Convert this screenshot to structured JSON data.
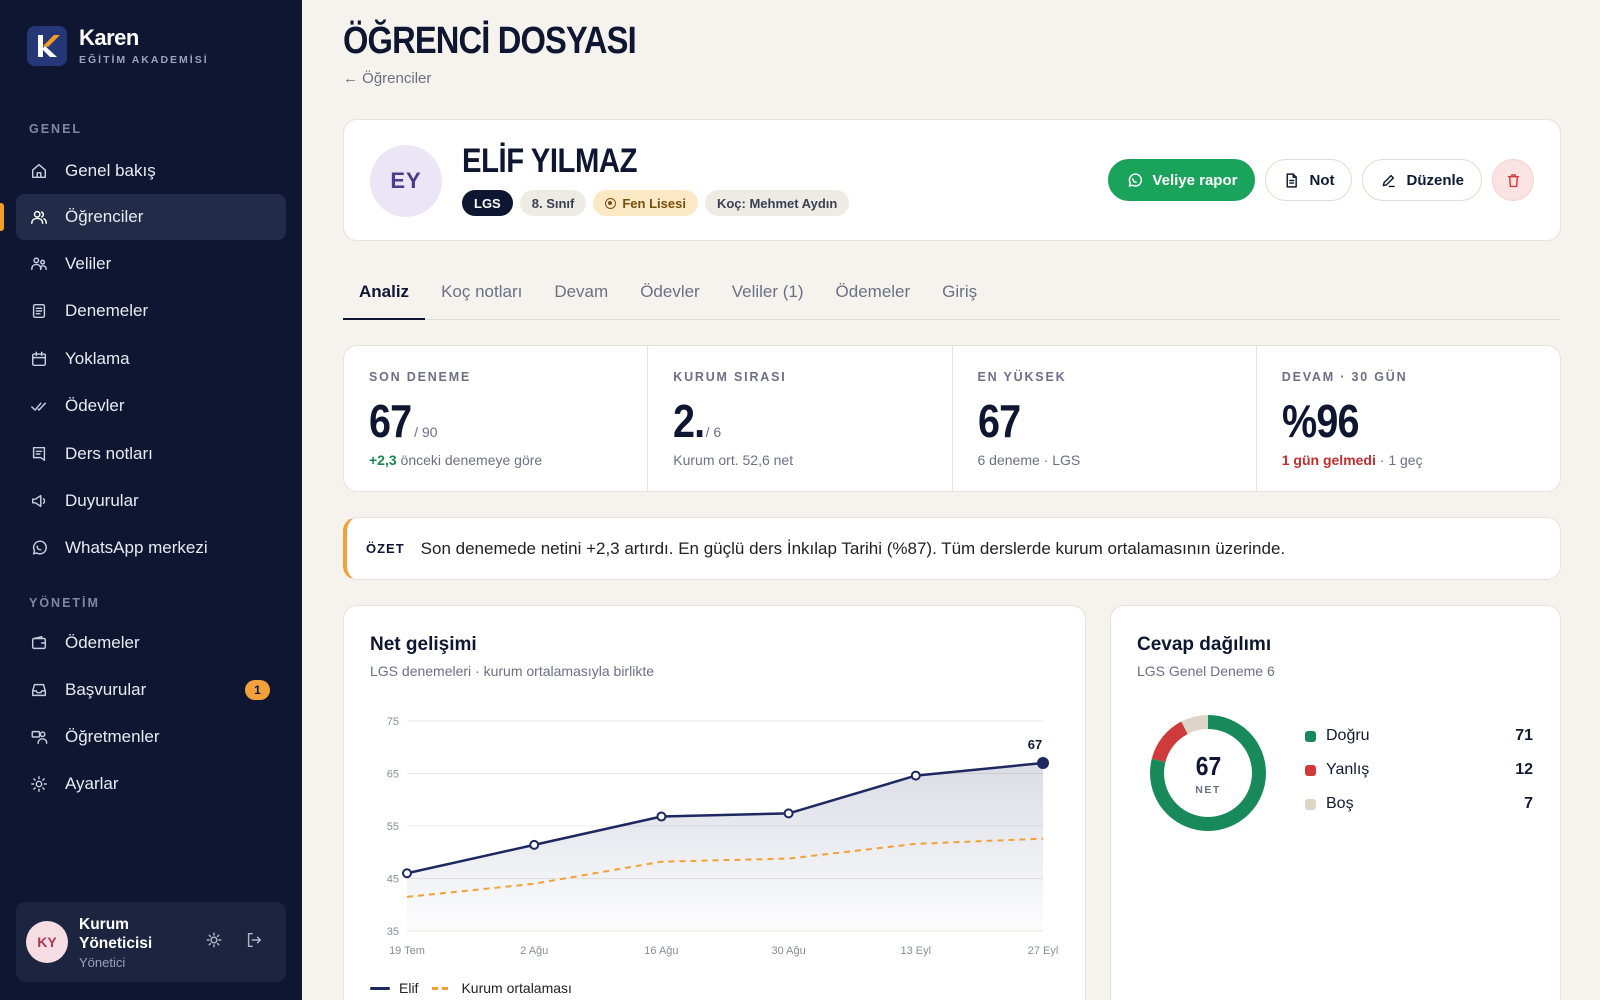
{
  "brand": {
    "name": "Karen",
    "subtitle": "EĞİTİM AKADEMİSİ"
  },
  "sidebar": {
    "section_general": "GENEL",
    "general_items": [
      {
        "label": "Genel bakış",
        "icon": "home-icon"
      },
      {
        "label": "Öğrenciler",
        "icon": "users-icon",
        "active": true
      },
      {
        "label": "Veliler",
        "icon": "parents-icon"
      },
      {
        "label": "Denemeler",
        "icon": "document-icon"
      },
      {
        "label": "Yoklama",
        "icon": "calendar-icon"
      },
      {
        "label": "Ödevler",
        "icon": "double-check-icon"
      },
      {
        "label": "Ders notları",
        "icon": "notes-icon"
      },
      {
        "label": "Duyurular",
        "icon": "megaphone-icon"
      },
      {
        "label": "WhatsApp merkezi",
        "icon": "whatsapp-icon"
      }
    ],
    "section_admin": "YÖNETİM",
    "admin_items": [
      {
        "label": "Ödemeler",
        "icon": "wallet-icon"
      },
      {
        "label": "Başvurular",
        "icon": "inbox-icon",
        "badge": "1"
      },
      {
        "label": "Öğretmenler",
        "icon": "teacher-icon"
      },
      {
        "label": "Ayarlar",
        "icon": "settings-icon"
      }
    ],
    "user": {
      "initials": "KY",
      "name": "Kurum Yöneticisi",
      "role": "Yönetici"
    }
  },
  "page": {
    "title": "ÖĞRENCİ DOSYASI",
    "back": "← Öğrenciler"
  },
  "student": {
    "initials": "EY",
    "name": "ELİF YILMAZ",
    "chips": {
      "exam": "LGS",
      "grade": "8. Sınıf",
      "target": "Fen Lisesi",
      "coach": "Koç: Mehmet Aydın"
    },
    "actions": {
      "report": "Veliye rapor",
      "note": "Not",
      "edit": "Düzenle"
    }
  },
  "tabs": [
    "Analiz",
    "Koç notları",
    "Devam",
    "Ödevler",
    "Veliler (1)",
    "Ödemeler",
    "Giriş"
  ],
  "stats": [
    {
      "label": "SON DENEME",
      "value": "67",
      "unit": "/ 90",
      "note_hl": "+2,3",
      "note": " önceki denemeye göre"
    },
    {
      "label": "KURUM SIRASI",
      "value": "2.",
      "unit": "/ 6",
      "note_hl": "",
      "note": "Kurum ort. 52,6 net"
    },
    {
      "label": "EN YÜKSEK",
      "value": "67",
      "unit": "",
      "note_hl": "",
      "note": "6 deneme · LGS"
    },
    {
      "label": "DEVAM · 30 GÜN",
      "value": "%96",
      "unit": "",
      "note_hl": "1 gün gelmedi",
      "note": " · 1 geç"
    }
  ],
  "summary": {
    "tag": "ÖZET",
    "text": "Son denemede netini +2,3 artırdı. En güçlü ders İnkılap Tarihi (%87). Tüm derslerde kurum ortalamasının üzerinde."
  },
  "chart_card": {
    "title": "Net gelişimi",
    "subtitle": "LGS denemeleri · kurum ortalamasıyla birlikte"
  },
  "chart_data": {
    "type": "line",
    "title": "Net gelişimi",
    "subtitle": "LGS denemeleri · kurum ortalamasıyla birlikte",
    "categories": [
      "19 Tem",
      "2 Ağu",
      "16 Ağu",
      "30 Ağu",
      "13 Eyl",
      "27 Eyl"
    ],
    "series": [
      {
        "name": "Elif",
        "values": [
          46,
          51.4,
          56.8,
          57.4,
          64.6,
          67
        ],
        "color": "#1d2760",
        "style": "solid-area"
      },
      {
        "name": "Kurum ortalaması",
        "values": [
          41.5,
          44,
          48.2,
          48.8,
          51.6,
          52.6
        ],
        "color": "#f0a238",
        "style": "dashed"
      }
    ],
    "ylim": [
      35,
      75
    ],
    "yticks": [
      35,
      45,
      55,
      65,
      75
    ],
    "last_label": "67",
    "grid": true,
    "legend": "bottom-left"
  },
  "distribution": {
    "title": "Cevap dağılımı",
    "subtitle": "LGS Genel Deneme 6",
    "center_value": "67",
    "center_label": "NET",
    "items": [
      {
        "name": "Doğru",
        "value": 71,
        "color": "#17895a"
      },
      {
        "name": "Yanlış",
        "value": 12,
        "color": "#cf3b3b"
      },
      {
        "name": "Boş",
        "value": 7,
        "color": "#ddd6c8"
      }
    ]
  }
}
